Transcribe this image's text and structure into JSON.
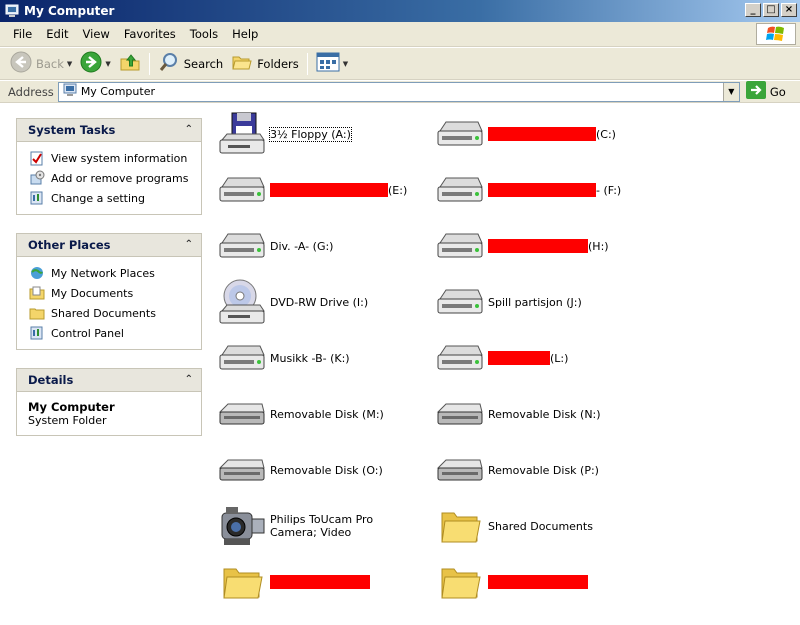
{
  "window": {
    "title": "My Computer"
  },
  "titlebar_buttons": [
    "_",
    "□",
    "×"
  ],
  "menu": [
    "File",
    "Edit",
    "View",
    "Favorites",
    "Tools",
    "Help"
  ],
  "toolbar": {
    "back": "Back",
    "search": "Search",
    "folders": "Folders"
  },
  "address": {
    "label": "Address",
    "value": "My Computer",
    "go": "Go"
  },
  "system_tasks": {
    "title": "System Tasks",
    "items": [
      "View system information",
      "Add or remove programs",
      "Change a setting"
    ]
  },
  "other_places": {
    "title": "Other Places",
    "items": [
      "My Network Places",
      "My Documents",
      "Shared Documents",
      "Control Panel"
    ]
  },
  "details": {
    "title": "Details",
    "name": "My Computer",
    "type": "System Folder"
  },
  "drives": [
    {
      "label": "3½ Floppy (A:)",
      "icon": "floppy-drive-icon"
    },
    {
      "label": "(C:)",
      "icon": "hard-drive-icon"
    },
    {
      "label": "(E:)",
      "icon": "hard-drive-icon"
    },
    {
      "label": "- (F:)",
      "icon": "hard-drive-icon"
    },
    {
      "label": "Div. -A- (G:)",
      "icon": "hard-drive-icon"
    },
    {
      "label": "(H:)",
      "icon": "hard-drive-icon"
    },
    {
      "label": "DVD-RW Drive (I:)",
      "icon": "dvd-drive-icon"
    },
    {
      "label": "Spill partisjon (J:)",
      "icon": "hard-drive-icon"
    },
    {
      "label": "Musikk -B- (K:)",
      "icon": "hard-drive-icon"
    },
    {
      "label": "(L:)",
      "icon": "hard-drive-icon"
    },
    {
      "label": "Removable Disk (M:)",
      "icon": "removable-disk-icon"
    },
    {
      "label": "Removable Disk (N:)",
      "icon": "removable-disk-icon"
    },
    {
      "label": "Removable Disk (O:)",
      "icon": "removable-disk-icon"
    },
    {
      "label": "Removable Disk (P:)",
      "icon": "removable-disk-icon"
    },
    {
      "label": "Philips ToUcam Pro Camera; Video",
      "icon": "camera-icon"
    },
    {
      "label": "Shared Documents",
      "icon": "folder-icon"
    },
    {
      "label": "",
      "icon": "folder-icon"
    },
    {
      "label": "",
      "icon": "folder-icon"
    }
  ],
  "colors": {
    "redaction": "#fe0000",
    "titlebar": "#0a246a",
    "chrome": "#ece9d8"
  }
}
